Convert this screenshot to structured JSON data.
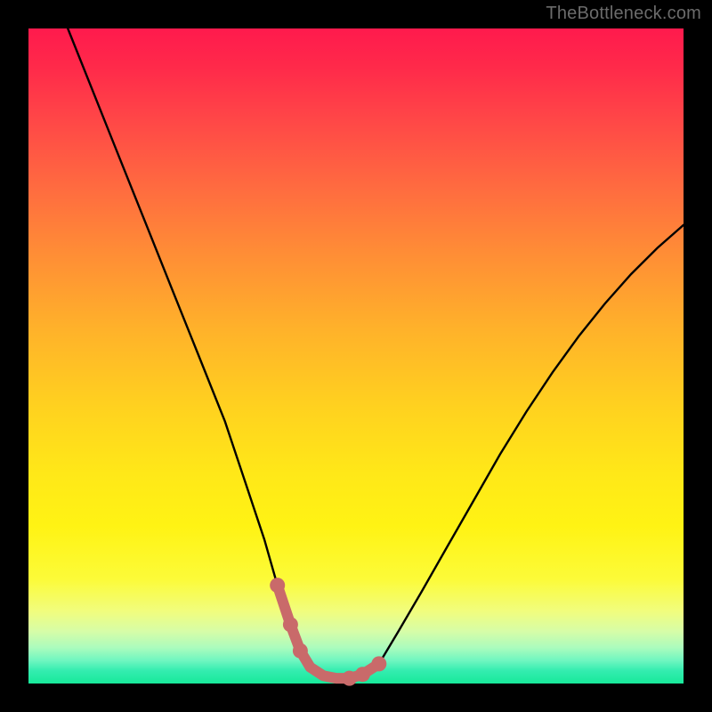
{
  "watermark": "TheBottleneck.com",
  "chart_data": {
    "type": "line",
    "title": "",
    "xlabel": "",
    "ylabel": "",
    "xlim": [
      0,
      100
    ],
    "ylim": [
      0,
      100
    ],
    "grid": false,
    "series": [
      {
        "name": "bottleneck-curve",
        "color": "#000000",
        "x": [
          6,
          10,
          14,
          18,
          22,
          26,
          30,
          33,
          36,
          38,
          40,
          41.5,
          43,
          45,
          47,
          49,
          51,
          53.5,
          56.5,
          60,
          64,
          68,
          72,
          76,
          80,
          84,
          88,
          92,
          96,
          100
        ],
        "y": [
          100,
          90,
          80,
          70,
          60,
          50,
          40,
          31,
          22,
          15,
          9,
          5,
          2.5,
          1.2,
          0.8,
          0.8,
          1.4,
          3,
          8,
          14,
          21,
          28,
          35,
          41.5,
          47.5,
          53,
          58,
          62.5,
          66.5,
          70
        ]
      },
      {
        "name": "highlight-valley",
        "color": "#cc6666",
        "x": [
          38,
          40,
          41.5,
          43,
          45,
          47,
          49,
          51,
          53.5
        ],
        "y": [
          15,
          9,
          5,
          2.5,
          1.2,
          0.8,
          0.8,
          1.4,
          3
        ],
        "marker": true
      }
    ],
    "annotations": []
  }
}
